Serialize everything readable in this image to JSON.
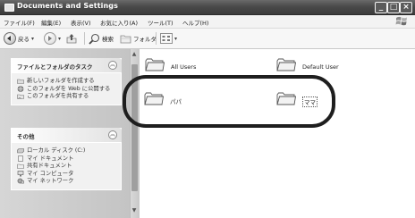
{
  "window": {
    "title": "Documents and Settings"
  },
  "menu": [
    "ファイル(F)",
    "編集(E)",
    "表示(V)",
    "お気に入り(A)",
    "ツール(T)",
    "ヘルプ(H)"
  ],
  "toolbar": {
    "back_label": "戻る",
    "search_label": "検索",
    "folders_label": "フォルダ"
  },
  "tasks_panel": {
    "title": "ファイルとフォルダのタスク",
    "items": [
      "新しいフォルダを作成する",
      "このフォルダを Web に公開する",
      "このフォルダを共有する"
    ]
  },
  "other_panel": {
    "title": "その他",
    "items": [
      "ローカル ディスク (C:)",
      "マイ ドキュメント",
      "共有ドキュメント",
      "マイ コンピュータ",
      "マイ ネットワーク"
    ]
  },
  "folders": [
    {
      "name": "All Users"
    },
    {
      "name": "Default User"
    },
    {
      "name": "パパ"
    },
    {
      "name": "ママ"
    }
  ],
  "colors": {
    "titlebar": "#4a4a4a",
    "highlight_border": "#1e1e1e"
  }
}
